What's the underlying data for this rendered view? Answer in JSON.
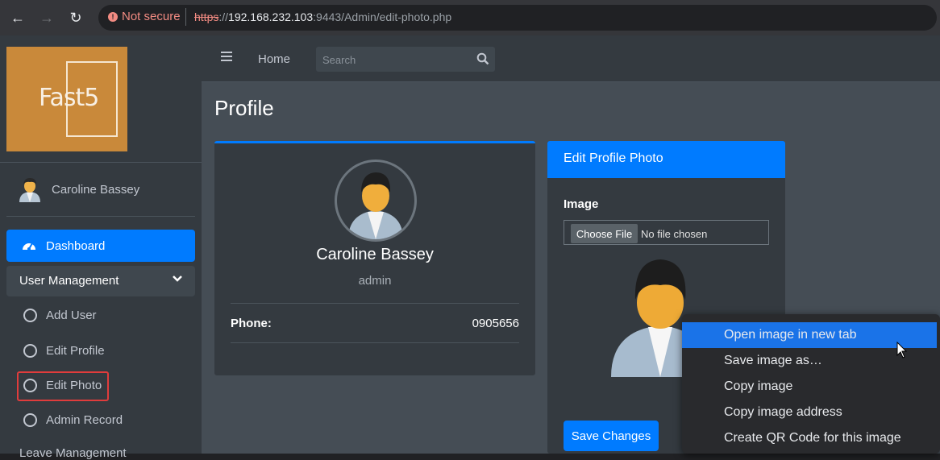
{
  "browser": {
    "security_label": "Not secure",
    "url_scheme": "https",
    "url_sep": "://",
    "url_host": "192.168.232.103",
    "url_rest": ":9443/Admin/edit-photo.php"
  },
  "sidebar": {
    "logo_text": "Fast5",
    "user_name": "Caroline Bassey",
    "dashboard_label": "Dashboard",
    "user_management_label": "User Management",
    "items": [
      {
        "label": "Add User"
      },
      {
        "label": "Edit Profile"
      },
      {
        "label": "Edit Photo"
      },
      {
        "label": "Admin Record"
      }
    ],
    "leave_management_label": "Leave Management"
  },
  "topnav": {
    "home_label": "Home",
    "search_placeholder": "Search"
  },
  "page": {
    "title": "Profile"
  },
  "profile_card": {
    "name": "Caroline Bassey",
    "role": "admin",
    "phone_label": "Phone:",
    "phone_value": "0905656"
  },
  "photo_card": {
    "title": "Edit Profile Photo",
    "image_label": "Image",
    "choose_file_label": "Choose File",
    "no_file_text": "No file chosen",
    "save_label": "Save Changes"
  },
  "context_menu": {
    "items": [
      {
        "label": "Open image in new tab"
      },
      {
        "label": "Save image as…"
      },
      {
        "label": "Copy image"
      },
      {
        "label": "Copy image address"
      },
      {
        "label": "Create QR Code for this image"
      }
    ]
  },
  "colors": {
    "accent": "#007bff",
    "sidebar_bg": "#343a40",
    "content_bg": "#454d55",
    "highlight_border": "#e03c3c",
    "menu_highlight": "#1a73e8"
  }
}
